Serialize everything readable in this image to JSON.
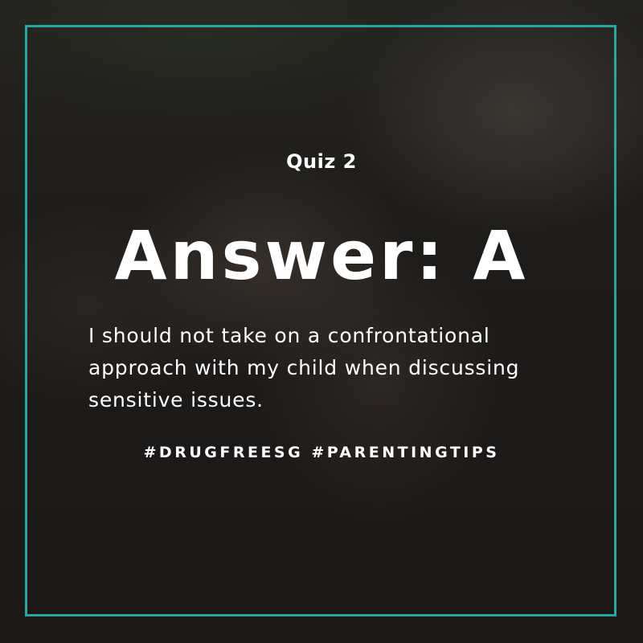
{
  "quiz": {
    "label": "Quiz 2"
  },
  "answer": {
    "title": "Answer: A"
  },
  "explanation": {
    "lines": [
      "I should not take on a confrontational",
      "approach with my child when discussing",
      "sensitive issues."
    ]
  },
  "hashtags": {
    "text": "#DRUGFREESG #PARENTINGTIPS"
  },
  "colors": {
    "frame": "#27a7a1",
    "text": "#ffffff",
    "overlay": "#141211"
  }
}
